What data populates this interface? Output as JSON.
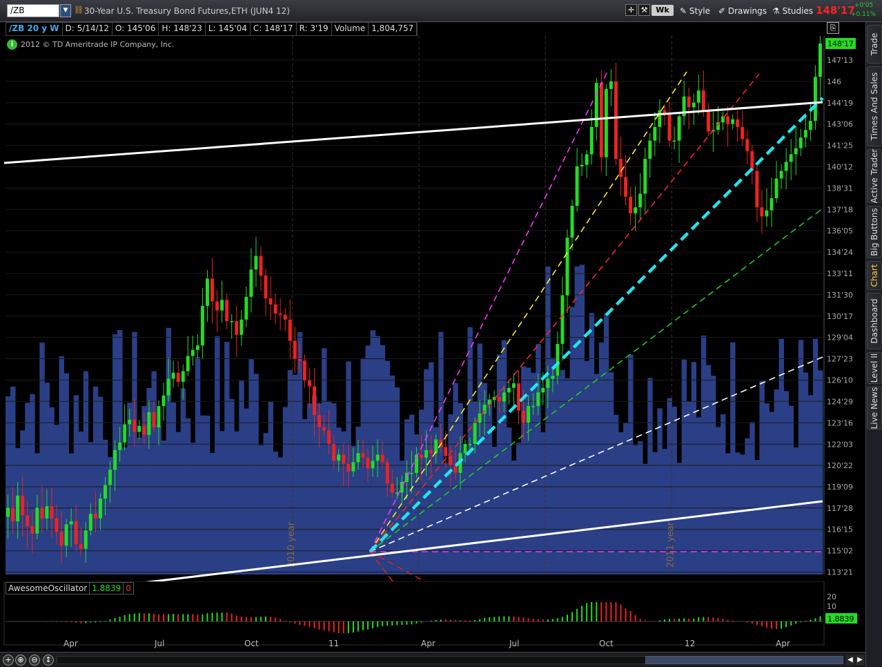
{
  "toolbar": {
    "symbol": "/ZB",
    "title": "30-Year U.S. Treasury Bond Futures,ETH (JUN4 12)",
    "aggregation": "Wk",
    "style_label": "Style",
    "drawings_label": "Drawings",
    "studies_label": "Studies",
    "last_price": "148'17",
    "change_abs": "+0'05",
    "change_pct": "+0.11%"
  },
  "infobar": {
    "symbol_period": "/ZB 20 y W",
    "date": "D: 5/14/12",
    "open": "O: 145'06",
    "high": "H: 148'23",
    "low": "L: 145'04",
    "close": "C: 148'17",
    "range": "R: 3'19",
    "volume_label": "Volume",
    "volume": "1,804,757"
  },
  "copyright": "2012 © TD Ameritrade IP Company, Inc.",
  "price_axis": {
    "ticks": [
      "147'13",
      "146",
      "144'19",
      "143'06",
      "141'25",
      "140'12",
      "138'31",
      "137'18",
      "136'05",
      "134'24",
      "133'11",
      "131'30",
      "130'17",
      "129'04",
      "127'23",
      "126'10",
      "124'29",
      "123'16",
      "122'03",
      "120'22",
      "119'09",
      "117'28",
      "116'15",
      "115'02",
      "113'21"
    ],
    "last_label": "148'17"
  },
  "time_axis": {
    "labels": [
      "Apr",
      "Jul",
      "Oct",
      "11",
      "Apr",
      "Jul",
      "Oct",
      "12",
      "Apr"
    ]
  },
  "year_markers": [
    "2010 year",
    "2011 year"
  ],
  "oscillator": {
    "name": "AwesomeOscillator",
    "value": "1.8839",
    "zero": "0",
    "ticks": [
      "20",
      "10"
    ],
    "last_label": "1.8839"
  },
  "sidebar": {
    "tabs": [
      "Trade",
      "Times And Sales",
      "Active Trader",
      "Big Buttons",
      "Chart",
      "Dashboard",
      "Level II",
      "Live News"
    ],
    "active": "Chart"
  },
  "colors": {
    "up": "#22dd22",
    "down": "#ee2222",
    "volume": "#2a3f86",
    "accent_last": "#22dd22"
  },
  "chart_data": {
    "type": "candlestick",
    "price_unit": "points (32nds)",
    "ylim": [
      113.5,
      149
    ],
    "weeks": 177,
    "closes": [
      117.9,
      117.0,
      118.7,
      117.4,
      116.7,
      116.2,
      117.9,
      117.2,
      118.0,
      117.2,
      116.3,
      115.4,
      116.8,
      117.0,
      115.5,
      115.2,
      116.4,
      117.5,
      117.2,
      118.5,
      119.4,
      120.4,
      121.7,
      122.2,
      123.4,
      123.7,
      122.9,
      123.3,
      122.7,
      124.2,
      123.2,
      124.6,
      125.3,
      126.4,
      126.8,
      126.2,
      126.9,
      127.9,
      128.3,
      128.6,
      131.2,
      133.0,
      131.5,
      130.9,
      131.6,
      130.2,
      130.2,
      129.3,
      130.3,
      131.8,
      133.6,
      134.5,
      133.2,
      131.7,
      131.3,
      130.7,
      130.6,
      130.3,
      128.9,
      127.7,
      127.6,
      126.3,
      125.9,
      124.0,
      123.2,
      123.0,
      122.1,
      121.0,
      121.4,
      120.8,
      120.3,
      120.9,
      121.5,
      121.2,
      120.5,
      121.0,
      121.4,
      120.9,
      119.5,
      118.9,
      118.9,
      119.6,
      120.2,
      120.2,
      121.4,
      121.2,
      121.7,
      121.5,
      122.4,
      121.9,
      121.3,
      120.7,
      120.2,
      121.5,
      122.1,
      122.1,
      123.5,
      124.1,
      124.7,
      125.0,
      125.2,
      124.9,
      125.5,
      125.8,
      126.1,
      124.3,
      123.5,
      124.6,
      124.6,
      125.5,
      125.8,
      126.4,
      126.6,
      128.7,
      131.9,
      135.7,
      137.8,
      140.4,
      140.5,
      141.2,
      143.0,
      145.9,
      141.0,
      145.5,
      146.0,
      140.9,
      139.7,
      138.4,
      137.3,
      137.7,
      138.6,
      140.9,
      142.1,
      143.0,
      144.1,
      143.9,
      142.1,
      142.1,
      143.7,
      145.0,
      144.3,
      144.6,
      145.4,
      144.1,
      142.7,
      142.8,
      143.3,
      143.7,
      143.2,
      143.5,
      143.0,
      142.2,
      141.4,
      140.1,
      137.7,
      137.1,
      137.5,
      138.3,
      139.6,
      140.1,
      140.7,
      141.2,
      141.6,
      142.3,
      142.8,
      143.4,
      146.3,
      148.5
    ]
  }
}
